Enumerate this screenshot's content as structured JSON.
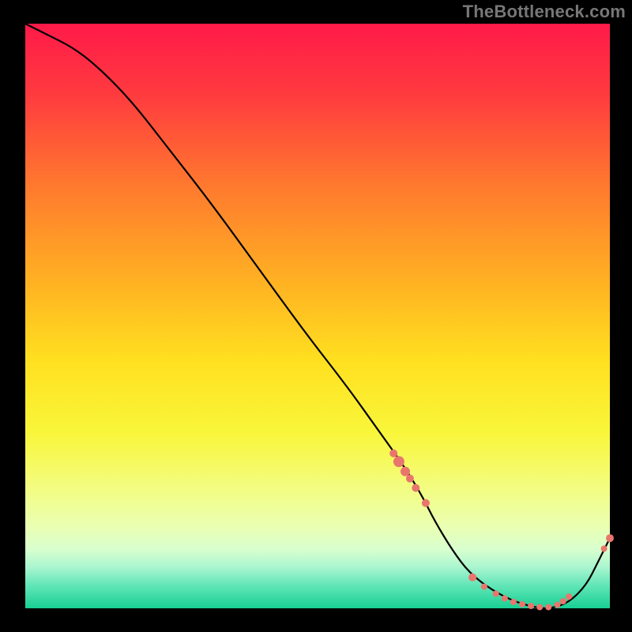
{
  "attribution": "TheBottleneck.com",
  "colors": {
    "page_bg": "#000000",
    "curve": "#000000",
    "marker_fill": "#e8766d",
    "attribution_text": "#777777"
  },
  "gradient_stops": [
    {
      "pct": 0,
      "color": "#ff1a49"
    },
    {
      "pct": 12,
      "color": "#ff3a3f"
    },
    {
      "pct": 28,
      "color": "#ff7a2e"
    },
    {
      "pct": 45,
      "color": "#ffb422"
    },
    {
      "pct": 58,
      "color": "#ffe120"
    },
    {
      "pct": 70,
      "color": "#f9f63a"
    },
    {
      "pct": 80,
      "color": "#f2fd85"
    },
    {
      "pct": 86,
      "color": "#eaffb2"
    },
    {
      "pct": 90,
      "color": "#d8ffcf"
    },
    {
      "pct": 93,
      "color": "#a8f5cf"
    },
    {
      "pct": 96,
      "color": "#63e6b8"
    },
    {
      "pct": 100,
      "color": "#18cf93"
    }
  ],
  "chart_data": {
    "type": "line",
    "title": "",
    "xlabel": "",
    "ylabel": "",
    "xlim": [
      0,
      100
    ],
    "ylim": [
      0,
      100
    ],
    "grid": false,
    "legend": false,
    "series": [
      {
        "name": "bottleneck-curve",
        "x": [
          0,
          4,
          8,
          12,
          18,
          25,
          32,
          40,
          48,
          55,
          60,
          65,
          68,
          70,
          73,
          76,
          80,
          84,
          88,
          90,
          93,
          96,
          98,
          100
        ],
        "y": [
          100,
          98,
          96,
          93,
          87,
          78,
          69,
          58,
          47,
          38,
          31,
          24,
          19,
          15,
          10,
          6,
          3,
          1,
          0,
          0,
          1,
          4,
          8,
          12
        ]
      }
    ],
    "markers": [
      {
        "x": 63.0,
        "y": 26.5,
        "r": 5
      },
      {
        "x": 63.9,
        "y": 25.1,
        "r": 7
      },
      {
        "x": 65.0,
        "y": 23.4,
        "r": 6
      },
      {
        "x": 65.8,
        "y": 22.2,
        "r": 5
      },
      {
        "x": 66.8,
        "y": 20.6,
        "r": 5
      },
      {
        "x": 68.5,
        "y": 18.0,
        "r": 5
      },
      {
        "x": 76.5,
        "y": 5.3,
        "r": 5
      },
      {
        "x": 78.5,
        "y": 3.7,
        "r": 4
      },
      {
        "x": 80.5,
        "y": 2.5,
        "r": 4
      },
      {
        "x": 82.0,
        "y": 1.7,
        "r": 4
      },
      {
        "x": 83.5,
        "y": 1.1,
        "r": 4
      },
      {
        "x": 85.0,
        "y": 0.7,
        "r": 4
      },
      {
        "x": 86.5,
        "y": 0.4,
        "r": 4
      },
      {
        "x": 88.0,
        "y": 0.2,
        "r": 4
      },
      {
        "x": 89.5,
        "y": 0.2,
        "r": 4
      },
      {
        "x": 91.0,
        "y": 0.6,
        "r": 4
      },
      {
        "x": 92.0,
        "y": 1.2,
        "r": 4
      },
      {
        "x": 93.0,
        "y": 2.0,
        "r": 4
      },
      {
        "x": 99.0,
        "y": 10.2,
        "r": 4
      },
      {
        "x": 100.0,
        "y": 12.0,
        "r": 5
      }
    ]
  }
}
